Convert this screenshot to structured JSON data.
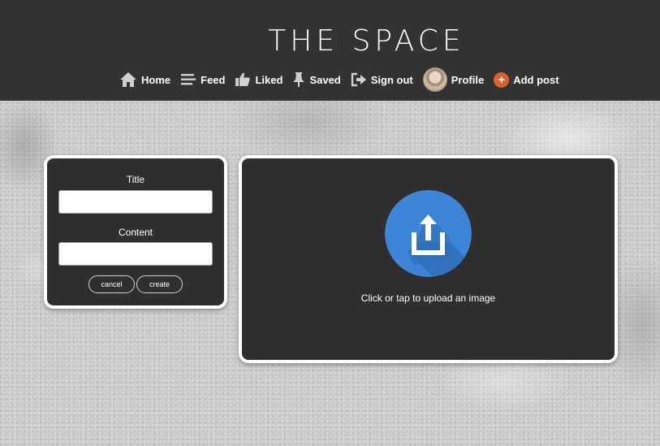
{
  "header": {
    "brand": "THE SPACE"
  },
  "nav": {
    "items": [
      {
        "label": "Home",
        "icon": "home-icon"
      },
      {
        "label": "Feed",
        "icon": "menu-lines-icon"
      },
      {
        "label": "Liked",
        "icon": "thumbs-up-icon"
      },
      {
        "label": "Saved",
        "icon": "pushpin-icon"
      },
      {
        "label": "Sign out",
        "icon": "sign-out-icon"
      },
      {
        "label": "Profile",
        "icon": "avatar"
      },
      {
        "label": "Add post",
        "icon": "plus-circle-icon"
      }
    ]
  },
  "form": {
    "title_label": "Title",
    "title_value": "",
    "content_label": "Content",
    "content_value": "",
    "cancel_label": "cancel",
    "create_label": "create"
  },
  "upload": {
    "prompt": "Click or tap to upload an image",
    "icon": "upload-icon"
  },
  "colors": {
    "header_bg": "#333333",
    "card_bg": "#2f2f2f",
    "upload_blue": "#3d85d8",
    "add_orange": "#d9612b"
  }
}
